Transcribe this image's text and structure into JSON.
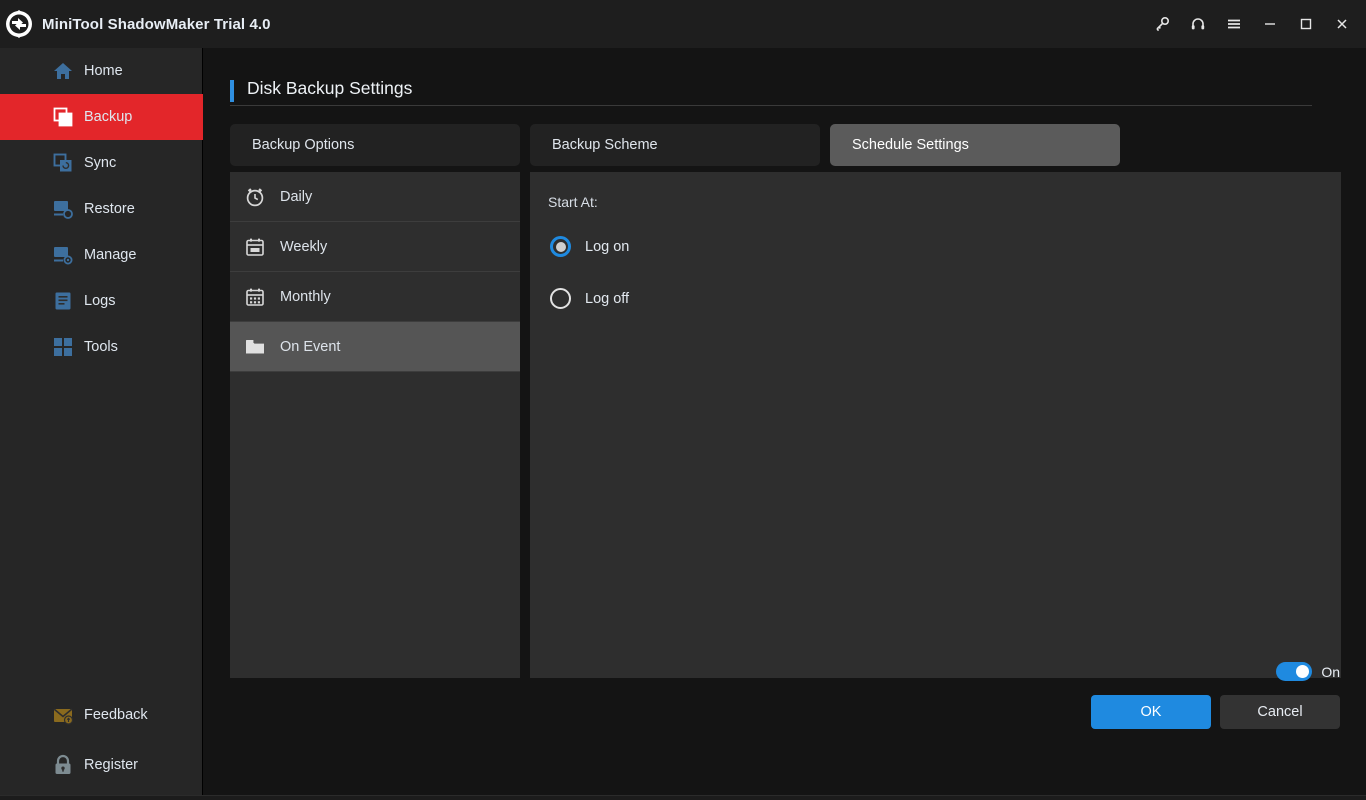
{
  "window": {
    "title": "MiniTool ShadowMaker Trial 4.0",
    "logo_icon": "refresh-circular-arrows-icon",
    "controls": [
      {
        "name": "key",
        "icon": "key-icon",
        "label": ""
      },
      {
        "name": "support",
        "icon": "headset-icon",
        "label": ""
      },
      {
        "name": "menu",
        "icon": "hamburger-menu-icon",
        "label": ""
      },
      {
        "name": "minimize",
        "icon": "minimize-icon",
        "label": ""
      },
      {
        "name": "maximize",
        "icon": "maximize-icon",
        "label": ""
      },
      {
        "name": "close",
        "icon": "close-icon",
        "label": ""
      }
    ]
  },
  "sidebar": {
    "items": [
      {
        "label": "Home",
        "icon": "home-icon",
        "active": false
      },
      {
        "label": "Backup",
        "icon": "backup-icon",
        "active": true
      },
      {
        "label": "Sync",
        "icon": "sync-icon",
        "active": false
      },
      {
        "label": "Restore",
        "icon": "restore-icon",
        "active": false
      },
      {
        "label": "Manage",
        "icon": "manage-icon",
        "active": false
      },
      {
        "label": "Logs",
        "icon": "logs-icon",
        "active": false
      },
      {
        "label": "Tools",
        "icon": "tools-icon",
        "active": false
      }
    ],
    "bottom_items": [
      {
        "label": "Feedback",
        "icon": "feedback-envelope-icon"
      },
      {
        "label": "Register",
        "icon": "lock-icon"
      }
    ],
    "active_color": "#e3262a"
  },
  "main": {
    "page_title": "Disk Backup Settings",
    "accent_color": "#2f8fe0",
    "tabs": [
      {
        "label": "Backup Options",
        "active": false
      },
      {
        "label": "Backup Scheme",
        "active": false
      },
      {
        "label": "Schedule Settings",
        "active": true
      }
    ],
    "schedule_list": [
      {
        "label": "Daily",
        "icon": "alarm-clock-icon",
        "selected": false
      },
      {
        "label": "Weekly",
        "icon": "calendar-icon",
        "selected": false
      },
      {
        "label": "Monthly",
        "icon": "calendar-grid-icon",
        "selected": false
      },
      {
        "label": "On Event",
        "icon": "folder-icon",
        "selected": true
      }
    ],
    "detail": {
      "start_at_label": "Start At:",
      "options": [
        {
          "label": "Log on",
          "selected": true
        },
        {
          "label": "Log off",
          "selected": false
        }
      ]
    }
  },
  "footer": {
    "toggle": {
      "state": "On",
      "enabled": true,
      "color": "#1f8ae0"
    },
    "ok_label": "OK",
    "cancel_label": "Cancel"
  }
}
